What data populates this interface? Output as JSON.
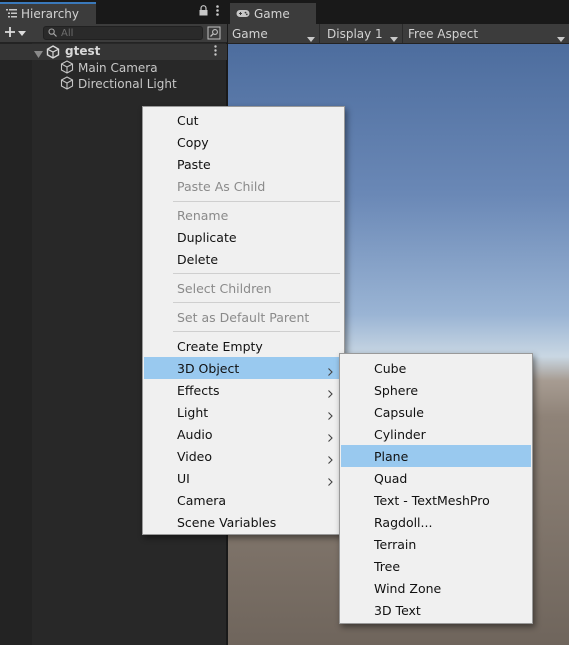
{
  "hierarchy": {
    "tab_label": "Hierarchy",
    "search_placeholder": "All",
    "scene_name": "gtest",
    "objects": [
      "Main Camera",
      "Directional Light"
    ]
  },
  "game": {
    "tab_label": "Game",
    "toolbar": {
      "mode": "Game",
      "display": "Display 1",
      "aspect": "Free Aspect"
    }
  },
  "context_menu": {
    "cut": "Cut",
    "copy": "Copy",
    "paste": "Paste",
    "paste_as_child": "Paste As Child",
    "rename": "Rename",
    "duplicate": "Duplicate",
    "delete": "Delete",
    "select_children": "Select Children",
    "set_default_parent": "Set as Default Parent",
    "create_empty": "Create Empty",
    "object_3d": "3D Object",
    "effects": "Effects",
    "light": "Light",
    "audio": "Audio",
    "video": "Video",
    "ui": "UI",
    "camera": "Camera",
    "scene_variables": "Scene Variables"
  },
  "submenu_3d": {
    "items": [
      "Cube",
      "Sphere",
      "Capsule",
      "Cylinder",
      "Plane",
      "Quad",
      "Text - TextMeshPro",
      "Ragdoll...",
      "Terrain",
      "Tree",
      "Wind Zone",
      "3D Text"
    ],
    "highlighted": "Plane"
  },
  "colors": {
    "menu_highlight": "#99c9ef",
    "active_tab_accent": "#3a79bb",
    "panel_bg": "#282828"
  }
}
